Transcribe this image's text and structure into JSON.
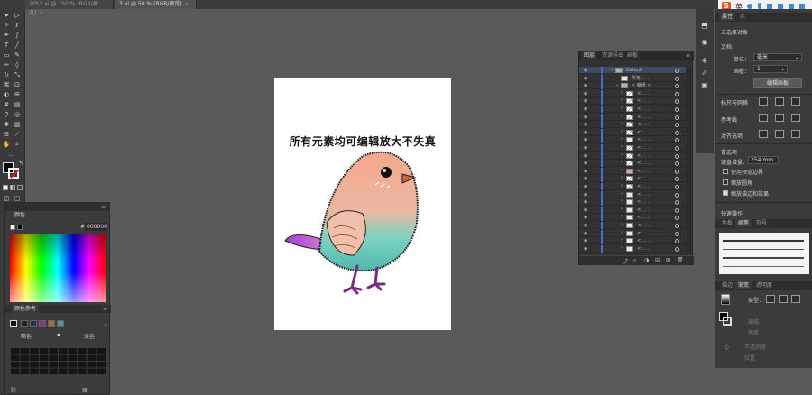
{
  "tabs": [
    {
      "label": "1053.ai @ 150 % (RGB/预览)",
      "active": false
    },
    {
      "label": "3.ai @ 50 % (RGB/预览)",
      "active": true
    }
  ],
  "tab_close_glyph": "×",
  "artboard": {
    "headline": "所有元素均可编辑放大不失真"
  },
  "color_panel": {
    "tab_label": "颜色",
    "hex_prefix": "#",
    "hex_value": "000000",
    "guide_tab_label": "颜色参考",
    "guide_left_label": "暗色",
    "guide_right_label": "淡色",
    "guide_swatches": [
      "#232323",
      "#2e2a55",
      "#7a3d86",
      "#9a7040",
      "#4f9a96"
    ]
  },
  "layers_panel": {
    "tabs": [
      "图层",
      "资源导出",
      "画板"
    ],
    "rows": [
      {
        "name": "Default",
        "indent": 0,
        "thumb": "image"
      },
      {
        "name": "所有 . . .",
        "indent": 1,
        "thumb": "blank"
      },
      {
        "name": "< 编组 >",
        "indent": 1,
        "thumb": "image"
      },
      {
        "name": "< . . .",
        "indent": 2,
        "thumb": "line"
      },
      {
        "name": "< . . .",
        "indent": 2,
        "thumb": "line"
      },
      {
        "name": "< . . .",
        "indent": 2,
        "thumb": "line"
      },
      {
        "name": "< . . .",
        "indent": 2,
        "thumb": "line"
      },
      {
        "name": "< . . .",
        "indent": 2,
        "thumb": "line"
      },
      {
        "name": "< . . .",
        "indent": 2,
        "thumb": "line"
      },
      {
        "name": "< . . .",
        "indent": 2,
        "thumb": "blank"
      },
      {
        "name": "< . . .",
        "indent": 2,
        "thumb": "line"
      },
      {
        "name": "< . . .",
        "indent": 2,
        "thumb": "line"
      },
      {
        "name": "< . . .",
        "indent": 2,
        "thumb": "line"
      },
      {
        "name": "< . . .",
        "indent": 2,
        "thumb": "red"
      },
      {
        "name": "< . . .",
        "indent": 2,
        "thumb": "line"
      },
      {
        "name": "< . . .",
        "indent": 2,
        "thumb": "line"
      },
      {
        "name": "< . . .",
        "indent": 2,
        "thumb": "blank"
      },
      {
        "name": "< . . .",
        "indent": 2,
        "thumb": "blank"
      },
      {
        "name": "< . . .",
        "indent": 2,
        "thumb": "blank"
      },
      {
        "name": "< . . .",
        "indent": 2,
        "thumb": "blank"
      },
      {
        "name": "< . . .",
        "indent": 2,
        "thumb": "blank"
      },
      {
        "name": "< . . .",
        "indent": 2,
        "thumb": "blank"
      },
      {
        "name": "< . . .",
        "indent": 2,
        "thumb": "blank"
      },
      {
        "name": "< . . .",
        "indent": 2,
        "thumb": "blank"
      }
    ]
  },
  "ime_bar": {
    "logo": "S",
    "label": "英"
  },
  "properties_panel": {
    "tabs": [
      "属性",
      "库"
    ],
    "no_selection": "未选择对象",
    "document_label": "文档",
    "units_label": "单位：",
    "units_value": "毫米",
    "artboard_label": "画板：",
    "artboard_value": "1",
    "edit_artboard_button": "编辑画板",
    "rulers_grid_label": "标尺与网格",
    "guides_label": "参考线",
    "snap_label": "对齐选项",
    "preferences_label": "首选项",
    "key_increment_label": "键盘增量：",
    "key_increment_value": "254 mm",
    "checkbox_preview_bounds": "使用预览边界",
    "checkbox_scale_corners": "缩放圆角",
    "checkbox_scale_strokes": "缩放描边和效果",
    "quick_actions_label": "快速操作",
    "swatch_tabs": [
      "色板",
      "画笔",
      "符号"
    ],
    "bottom_tabs": [
      "描边",
      "渐变",
      "透明度"
    ],
    "gradient_type_label": "类型：",
    "gradient_edit_label": "编辑",
    "gradient_angle_label": "角度",
    "gradient_opacity_label": "不透明度",
    "gradient_position_label": "位置"
  }
}
